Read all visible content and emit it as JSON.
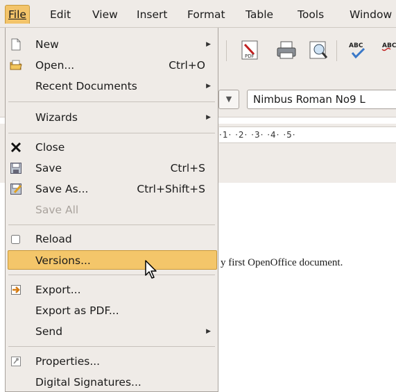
{
  "menubar": {
    "items": [
      "File",
      "Edit",
      "View",
      "Insert",
      "Format",
      "Table",
      "Tools",
      "Window"
    ]
  },
  "toolbar": {
    "font_name": "Nimbus Roman No9 L",
    "ruler_text": "·1· ·2· ·3· ·4· ·5·"
  },
  "document": {
    "visible_text": "y first OpenOffice document."
  },
  "file_menu": {
    "new": "New",
    "open": "Open...",
    "open_shortcut": "Ctrl+O",
    "recent": "Recent Documents",
    "wizards": "Wizards",
    "close": "Close",
    "save": "Save",
    "save_shortcut": "Ctrl+S",
    "save_as": "Save As...",
    "save_as_shortcut": "Ctrl+Shift+S",
    "save_all": "Save All",
    "reload": "Reload",
    "versions": "Versions...",
    "export": "Export...",
    "export_pdf": "Export as PDF...",
    "send": "Send",
    "properties": "Properties...",
    "digital_signatures": "Digital Signatures..."
  },
  "colors": {
    "highlight": "#f4c66a",
    "menu_bg": "#efebe7"
  }
}
